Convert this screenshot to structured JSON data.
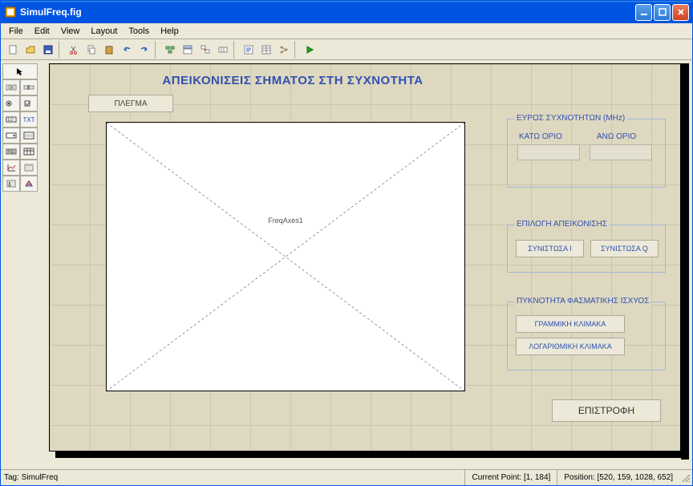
{
  "window": {
    "title": "SimulFreq.fig"
  },
  "menu": {
    "file": "File",
    "edit": "Edit",
    "view": "View",
    "layout": "Layout",
    "tools": "Tools",
    "help": "Help"
  },
  "toolbar": {
    "new": "new",
    "open": "open",
    "save": "save",
    "cut": "cut",
    "copy": "copy",
    "paste": "paste",
    "undo": "undo",
    "redo": "redo",
    "align": "align",
    "distribute": "distribute",
    "mfile": "mfile",
    "propinsp": "propinsp",
    "objbrowse": "objbrowse",
    "tabord": "tabord",
    "toolbar": "toolbar",
    "run": "run"
  },
  "figure": {
    "title": "ΑΠΕΙΚΟΝΙΣΕΙΣ ΣΗΜΑΤΟΣ ΣΤΗ ΣΥΧΝΟΤΗΤΑ",
    "plegma_btn": "ΠΛΕΓΜΑ",
    "axes_label": "FreqAxes1",
    "freq_group": {
      "legend": "ΕΥΡΟΣ ΣΥΧΝΟΤΗΤΩΝ (MHz)",
      "lower_label": "ΚΑΤΩ ΟΡΙΟ",
      "upper_label": "ΑΝΩ ΟΡΙΟ",
      "lower_value": "",
      "upper_value": ""
    },
    "display_group": {
      "legend": "ΕΠΙΛΟΓΗ ΑΠΕΙΚΟΝΙΣΗΣ",
      "comp_i": "ΣΥΝΙΣΤΩΣΑ Ι",
      "comp_q": "ΣΥΝΙΣΤΩΣΑ Q"
    },
    "psd_group": {
      "legend": "ΠΥΚΝΟΤΗΤΑ ΦΑΣΜΑΤΙΚΗΣ ΙΣΧΥΟΣ",
      "linear": "ΓΡΑΜΜΙΚΗ ΚΛΙΜΑΚΑ",
      "log": "ΛΟΓΑΡΙΘΜΙΚΗ ΚΛΙΜΑΚΑ"
    },
    "return_btn": "ΕΠΙΣΤΡΟΦΗ"
  },
  "status": {
    "tag": "Tag: SimulFreq",
    "current_point": "Current Point: [1, 184]",
    "position": "Position: [520, 159, 1028, 652]"
  },
  "palette": {
    "select": "select",
    "push": "push",
    "slider": "slider",
    "radio": "radio",
    "check": "check",
    "edit": "edit",
    "text": "text",
    "popup": "popup",
    "listbox": "listbox",
    "toggle": "toggle",
    "table": "table",
    "axes": "axes",
    "panel": "panel",
    "buttongroup": "buttongroup",
    "activex": "activex"
  }
}
